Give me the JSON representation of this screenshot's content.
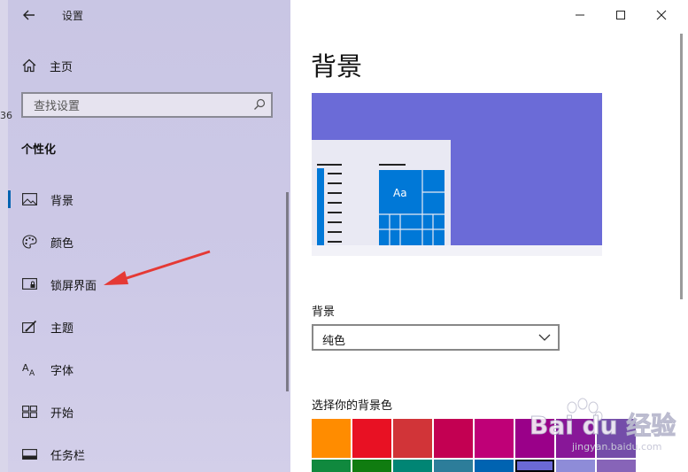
{
  "app": {
    "title": "设置",
    "edge_text": "36"
  },
  "home": {
    "label": "主页"
  },
  "search": {
    "placeholder": "查找设置"
  },
  "section": {
    "title": "个性化"
  },
  "nav": [
    {
      "label": "背景",
      "icon": "picture-icon",
      "selected": true
    },
    {
      "label": "颜色",
      "icon": "palette-icon"
    },
    {
      "label": "锁屏界面",
      "icon": "lock-screen-icon"
    },
    {
      "label": "主题",
      "icon": "theme-brush-icon"
    },
    {
      "label": "字体",
      "icon": "font-icon"
    },
    {
      "label": "开始",
      "icon": "start-tiles-icon"
    },
    {
      "label": "任务栏",
      "icon": "taskbar-icon"
    }
  ],
  "main": {
    "title": "背景",
    "preview_tile_text": "Aa",
    "background_label": "背景",
    "background_value": "纯色",
    "choose_color_label": "选择你的背景色"
  },
  "colors": {
    "accent": "#0063b1",
    "preview_bg": "#6b6bd7",
    "tile_blue": "#0078d7",
    "annotation_red": "#e53935",
    "swatches_row1": [
      "#ff8c00",
      "#e81123",
      "#d13438",
      "#c30052",
      "#bf0077",
      "#9a0089",
      "#881798",
      "#744da9"
    ],
    "swatches_row2": [
      "#10893e",
      "#107c10",
      "#018574",
      "#2d7d9a",
      "#0063b1",
      "#6b69d6",
      "#8e8cd8",
      "#8764b8"
    ]
  },
  "watermark": {
    "text": "jingyan.baidu.com",
    "logo_text": "Baidu 经验"
  }
}
